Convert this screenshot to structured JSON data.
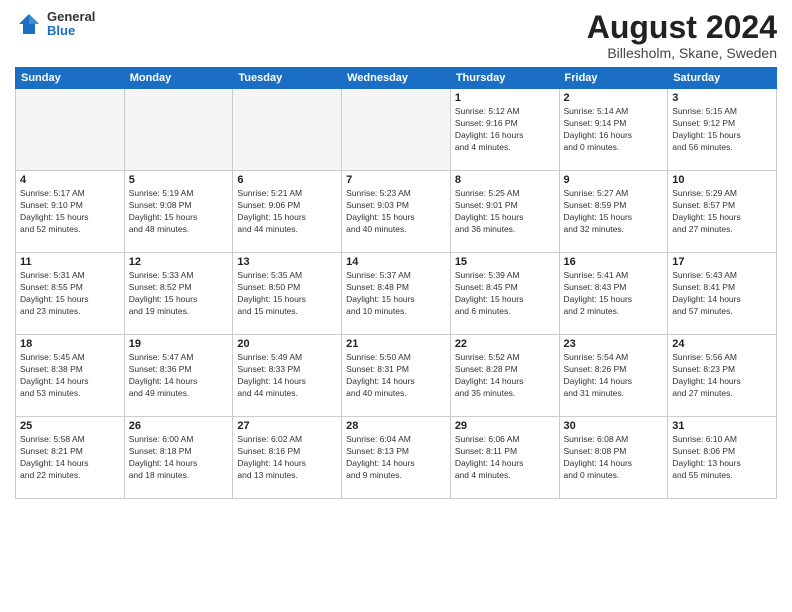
{
  "header": {
    "logo": {
      "general": "General",
      "blue": "Blue"
    },
    "title": "August 2024",
    "location": "Billesholm, Skane, Sweden"
  },
  "weekdays": [
    "Sunday",
    "Monday",
    "Tuesday",
    "Wednesday",
    "Thursday",
    "Friday",
    "Saturday"
  ],
  "weeks": [
    [
      {
        "day": "",
        "info": ""
      },
      {
        "day": "",
        "info": ""
      },
      {
        "day": "",
        "info": ""
      },
      {
        "day": "",
        "info": ""
      },
      {
        "day": "1",
        "info": "Sunrise: 5:12 AM\nSunset: 9:16 PM\nDaylight: 16 hours\nand 4 minutes."
      },
      {
        "day": "2",
        "info": "Sunrise: 5:14 AM\nSunset: 9:14 PM\nDaylight: 16 hours\nand 0 minutes."
      },
      {
        "day": "3",
        "info": "Sunrise: 5:15 AM\nSunset: 9:12 PM\nDaylight: 15 hours\nand 56 minutes."
      }
    ],
    [
      {
        "day": "4",
        "info": "Sunrise: 5:17 AM\nSunset: 9:10 PM\nDaylight: 15 hours\nand 52 minutes."
      },
      {
        "day": "5",
        "info": "Sunrise: 5:19 AM\nSunset: 9:08 PM\nDaylight: 15 hours\nand 48 minutes."
      },
      {
        "day": "6",
        "info": "Sunrise: 5:21 AM\nSunset: 9:06 PM\nDaylight: 15 hours\nand 44 minutes."
      },
      {
        "day": "7",
        "info": "Sunrise: 5:23 AM\nSunset: 9:03 PM\nDaylight: 15 hours\nand 40 minutes."
      },
      {
        "day": "8",
        "info": "Sunrise: 5:25 AM\nSunset: 9:01 PM\nDaylight: 15 hours\nand 36 minutes."
      },
      {
        "day": "9",
        "info": "Sunrise: 5:27 AM\nSunset: 8:59 PM\nDaylight: 15 hours\nand 32 minutes."
      },
      {
        "day": "10",
        "info": "Sunrise: 5:29 AM\nSunset: 8:57 PM\nDaylight: 15 hours\nand 27 minutes."
      }
    ],
    [
      {
        "day": "11",
        "info": "Sunrise: 5:31 AM\nSunset: 8:55 PM\nDaylight: 15 hours\nand 23 minutes."
      },
      {
        "day": "12",
        "info": "Sunrise: 5:33 AM\nSunset: 8:52 PM\nDaylight: 15 hours\nand 19 minutes."
      },
      {
        "day": "13",
        "info": "Sunrise: 5:35 AM\nSunset: 8:50 PM\nDaylight: 15 hours\nand 15 minutes."
      },
      {
        "day": "14",
        "info": "Sunrise: 5:37 AM\nSunset: 8:48 PM\nDaylight: 15 hours\nand 10 minutes."
      },
      {
        "day": "15",
        "info": "Sunrise: 5:39 AM\nSunset: 8:45 PM\nDaylight: 15 hours\nand 6 minutes."
      },
      {
        "day": "16",
        "info": "Sunrise: 5:41 AM\nSunset: 8:43 PM\nDaylight: 15 hours\nand 2 minutes."
      },
      {
        "day": "17",
        "info": "Sunrise: 5:43 AM\nSunset: 8:41 PM\nDaylight: 14 hours\nand 57 minutes."
      }
    ],
    [
      {
        "day": "18",
        "info": "Sunrise: 5:45 AM\nSunset: 8:38 PM\nDaylight: 14 hours\nand 53 minutes."
      },
      {
        "day": "19",
        "info": "Sunrise: 5:47 AM\nSunset: 8:36 PM\nDaylight: 14 hours\nand 49 minutes."
      },
      {
        "day": "20",
        "info": "Sunrise: 5:49 AM\nSunset: 8:33 PM\nDaylight: 14 hours\nand 44 minutes."
      },
      {
        "day": "21",
        "info": "Sunrise: 5:50 AM\nSunset: 8:31 PM\nDaylight: 14 hours\nand 40 minutes."
      },
      {
        "day": "22",
        "info": "Sunrise: 5:52 AM\nSunset: 8:28 PM\nDaylight: 14 hours\nand 35 minutes."
      },
      {
        "day": "23",
        "info": "Sunrise: 5:54 AM\nSunset: 8:26 PM\nDaylight: 14 hours\nand 31 minutes."
      },
      {
        "day": "24",
        "info": "Sunrise: 5:56 AM\nSunset: 8:23 PM\nDaylight: 14 hours\nand 27 minutes."
      }
    ],
    [
      {
        "day": "25",
        "info": "Sunrise: 5:58 AM\nSunset: 8:21 PM\nDaylight: 14 hours\nand 22 minutes."
      },
      {
        "day": "26",
        "info": "Sunrise: 6:00 AM\nSunset: 8:18 PM\nDaylight: 14 hours\nand 18 minutes."
      },
      {
        "day": "27",
        "info": "Sunrise: 6:02 AM\nSunset: 8:16 PM\nDaylight: 14 hours\nand 13 minutes."
      },
      {
        "day": "28",
        "info": "Sunrise: 6:04 AM\nSunset: 8:13 PM\nDaylight: 14 hours\nand 9 minutes."
      },
      {
        "day": "29",
        "info": "Sunrise: 6:06 AM\nSunset: 8:11 PM\nDaylight: 14 hours\nand 4 minutes."
      },
      {
        "day": "30",
        "info": "Sunrise: 6:08 AM\nSunset: 8:08 PM\nDaylight: 14 hours\nand 0 minutes."
      },
      {
        "day": "31",
        "info": "Sunrise: 6:10 AM\nSunset: 8:06 PM\nDaylight: 13 hours\nand 55 minutes."
      }
    ]
  ]
}
